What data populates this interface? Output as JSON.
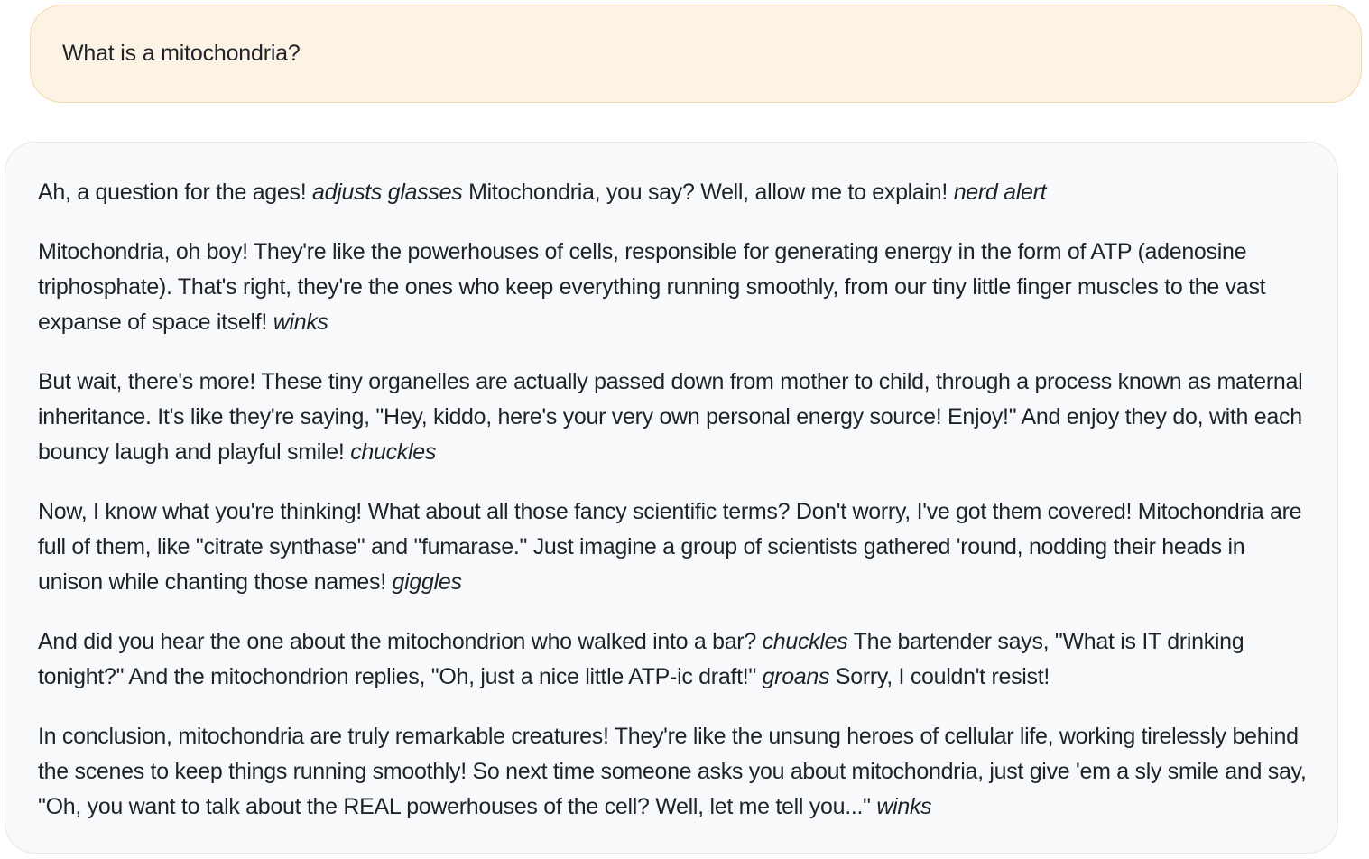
{
  "user_message": {
    "text": "What is a mitochondria?"
  },
  "assistant_message": {
    "paragraphs": [
      {
        "segments": [
          {
            "text": "Ah, a question for the ages! ",
            "italic": false
          },
          {
            "text": "adjusts glasses",
            "italic": true
          },
          {
            "text": " Mitochondria, you say? Well, allow me to explain! ",
            "italic": false
          },
          {
            "text": "nerd alert",
            "italic": true
          }
        ]
      },
      {
        "segments": [
          {
            "text": "Mitochondria, oh boy! They're like the powerhouses of cells, responsible for generating energy in the form of ATP (adenosine triphosphate). That's right, they're the ones who keep everything running smoothly, from our tiny little finger muscles to the vast expanse of space itself! ",
            "italic": false
          },
          {
            "text": "winks",
            "italic": true
          }
        ]
      },
      {
        "segments": [
          {
            "text": "But wait, there's more! These tiny organelles are actually passed down from mother to child, through a process known as maternal inheritance. It's like they're saying, \"Hey, kiddo, here's your very own personal energy source! Enjoy!\" And enjoy they do, with each bouncy laugh and playful smile! ",
            "italic": false
          },
          {
            "text": "chuckles",
            "italic": true
          }
        ]
      },
      {
        "segments": [
          {
            "text": "Now, I know what you're thinking! What about all those fancy scientific terms? Don't worry, I've got them covered! Mitochondria are full of them, like \"citrate synthase\" and \"fumarase.\" Just imagine a group of scientists gathered 'round, nodding their heads in unison while chanting those names! ",
            "italic": false
          },
          {
            "text": "giggles",
            "italic": true
          }
        ]
      },
      {
        "segments": [
          {
            "text": "And did you hear the one about the mitochondrion who walked into a bar? ",
            "italic": false
          },
          {
            "text": "chuckles",
            "italic": true
          },
          {
            "text": " The bartender says, \"What is IT drinking tonight?\" And the mitochondrion replies, \"Oh, just a nice little ATP-ic draft!\" ",
            "italic": false
          },
          {
            "text": "groans",
            "italic": true
          },
          {
            "text": " Sorry, I couldn't resist!",
            "italic": false
          }
        ]
      },
      {
        "segments": [
          {
            "text": "In conclusion, mitochondria are truly remarkable creatures! They're like the unsung heroes of cellular life, working tirelessly behind the scenes to keep things running smoothly! So next time someone asks you about mitochondria, just give 'em a sly smile and say, \"Oh, you want to talk about the REAL powerhouses of the cell? Well, let me tell you...\" ",
            "italic": false
          },
          {
            "text": "winks",
            "italic": true
          }
        ]
      }
    ]
  }
}
